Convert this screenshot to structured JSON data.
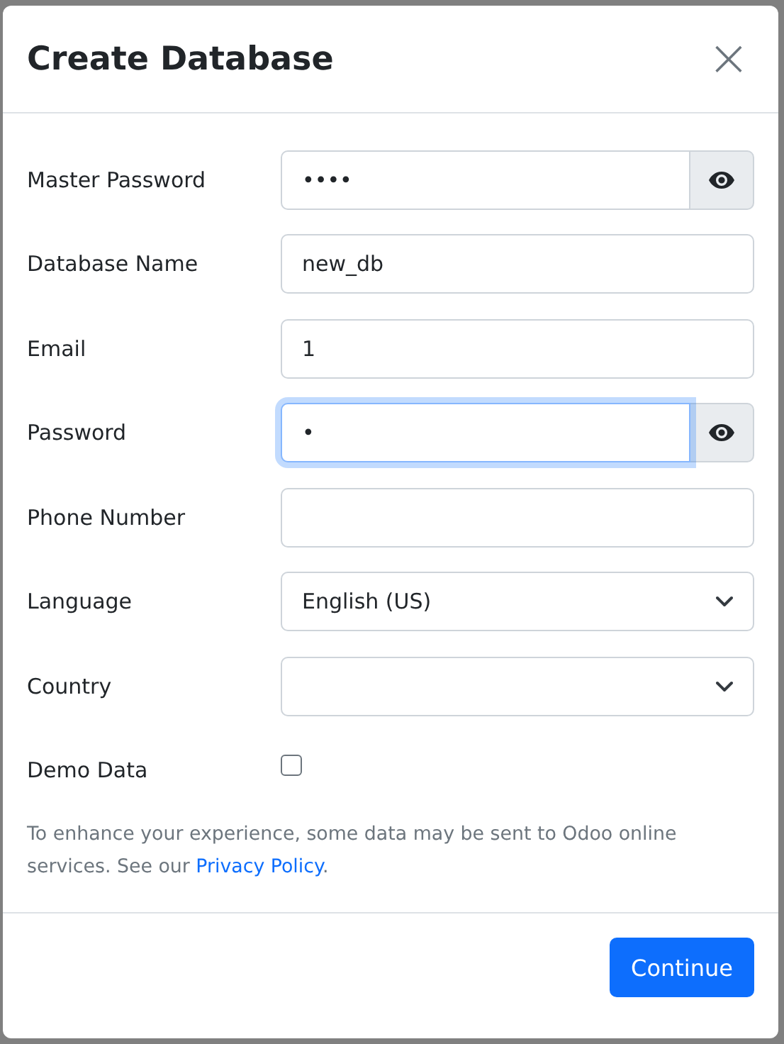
{
  "dialog": {
    "title": "Create Database",
    "close": "×"
  },
  "fields": [
    {
      "kind": "password",
      "label": "Master Password",
      "value": "••••",
      "focused": false
    },
    {
      "kind": "text",
      "label": "Database Name",
      "value": "new_db",
      "focused": false
    },
    {
      "kind": "text",
      "label": "Email",
      "value": "1",
      "focused": false
    },
    {
      "kind": "password",
      "label": "Password",
      "value": "•",
      "focused": true
    },
    {
      "kind": "text",
      "label": "Phone Number",
      "focused": false
    },
    {
      "kind": "select",
      "label": "Language",
      "value": "English (US)",
      "focused": false
    },
    {
      "kind": "select",
      "label": "Country",
      "focused": false
    },
    {
      "kind": "checkbox",
      "label": "Demo Data",
      "checked": false
    }
  ],
  "notice": {
    "text": "To enhance your experience, some data may be sent to Odoo online services. See our ",
    "link": "Privacy Policy",
    "end": "."
  },
  "buttons": [
    "Continue"
  ]
}
